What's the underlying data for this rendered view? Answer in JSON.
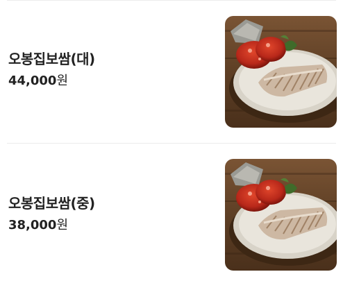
{
  "menu_items": [
    {
      "name": "오봉집보쌈(대)",
      "price": "44,000",
      "currency": "원",
      "image": "bossam-platter-photo"
    },
    {
      "name": "오봉집보쌈(중)",
      "price": "38,000",
      "currency": "원",
      "image": "bossam-platter-photo"
    }
  ],
  "colors": {
    "text": "#222222",
    "divider": "#ececec",
    "background": "#ffffff"
  }
}
